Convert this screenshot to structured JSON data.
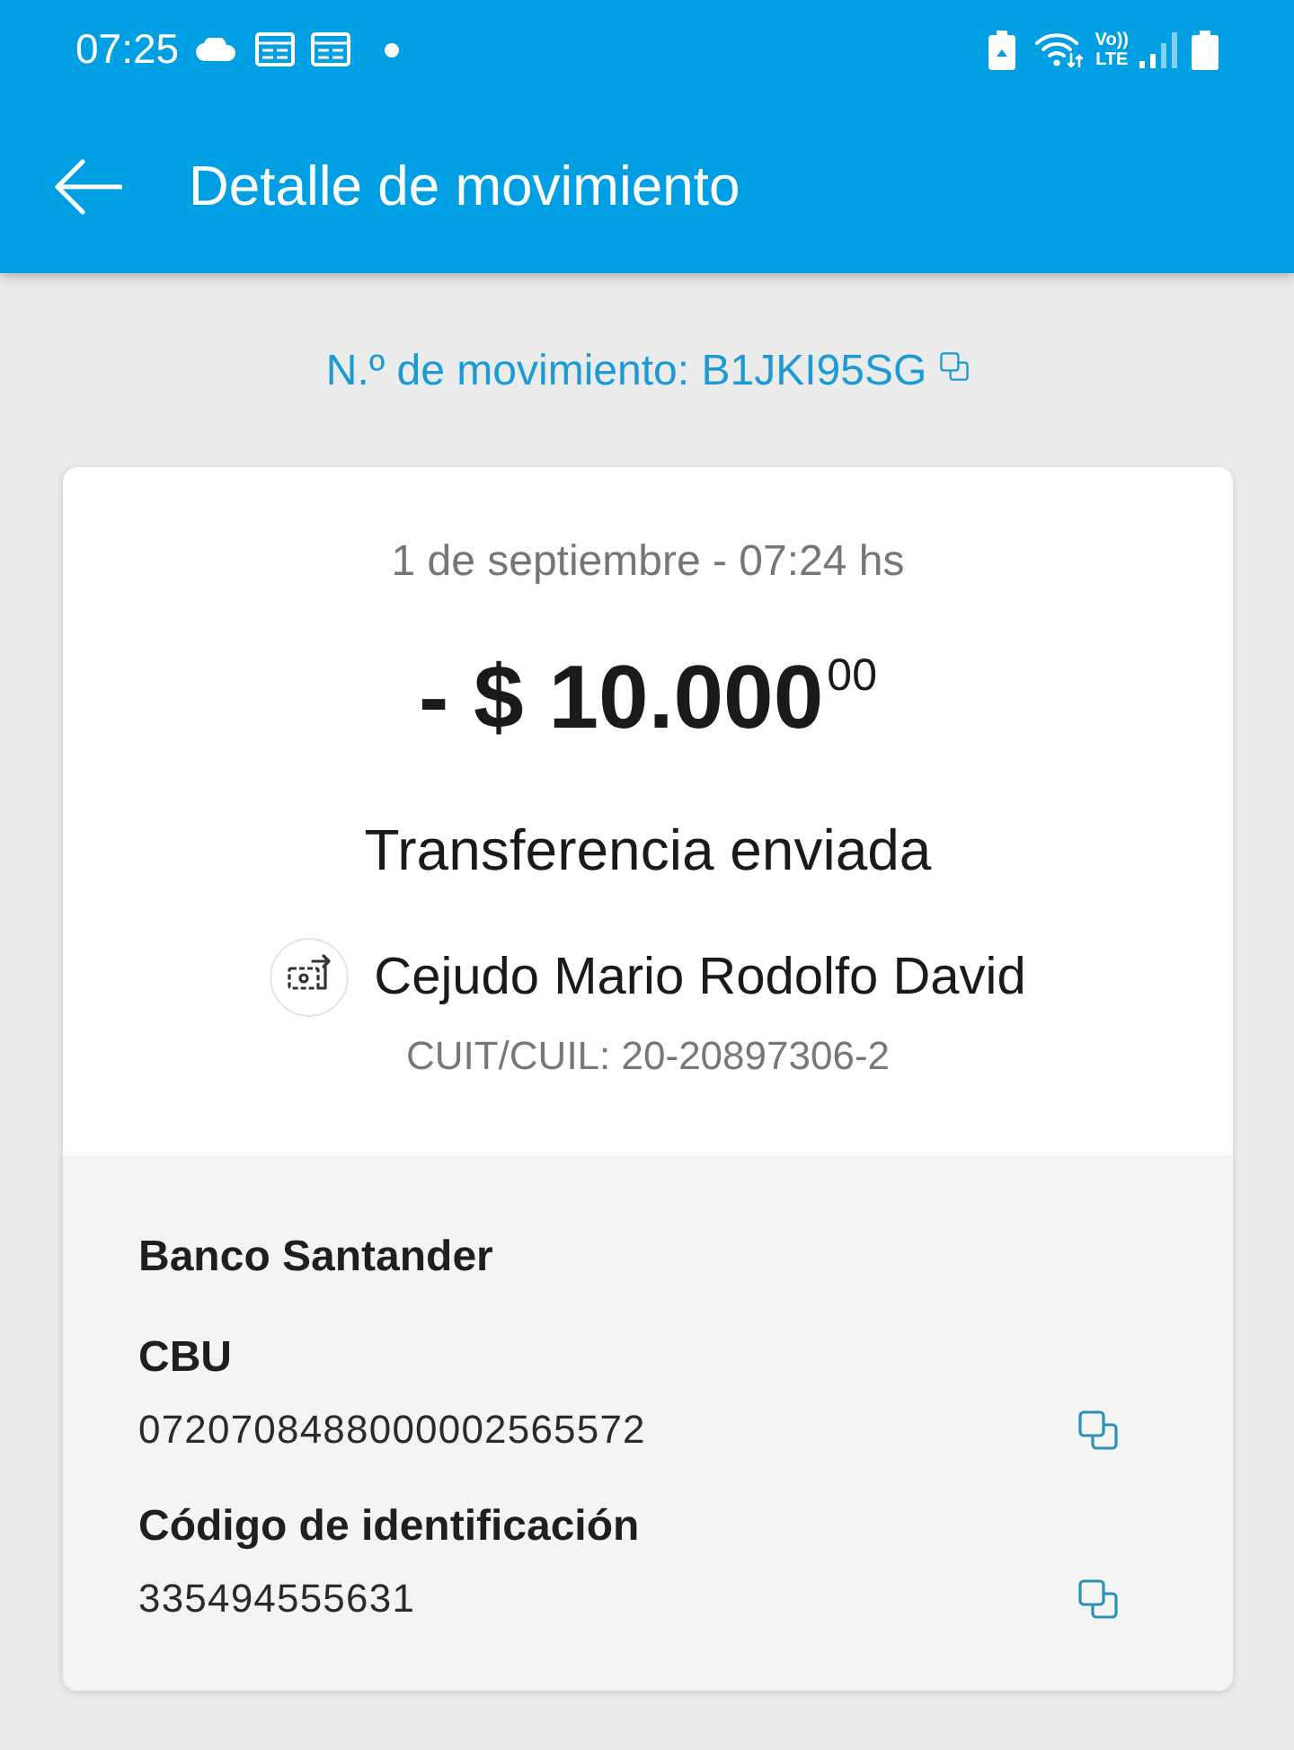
{
  "status_bar": {
    "time": "07:25",
    "network_top": "Vo))",
    "network_bottom": "LTE"
  },
  "app_bar": {
    "title": "Detalle de movimiento"
  },
  "movement_number": {
    "label": "N.º de movimiento: B1JKI95SG"
  },
  "transaction": {
    "date": "1 de septiembre - 07:24 hs",
    "amount": "- $ 10.000$^{00}$",
    "description": "Transferencia enviada",
    "recipient": {
      "name": "Cejudo Mario Rodolfo David",
      "tax_id": "CUIT/CUIL: 20-20897306-2"
    }
  },
  "account": {
    "bank": "Banco Santander",
    "fields": [
      {
        "label": "CBU",
        "value": "0720708488000002565572"
      },
      {
        "label": "Código de identificación",
        "value": "335494555631"
      }
    ]
  }
}
